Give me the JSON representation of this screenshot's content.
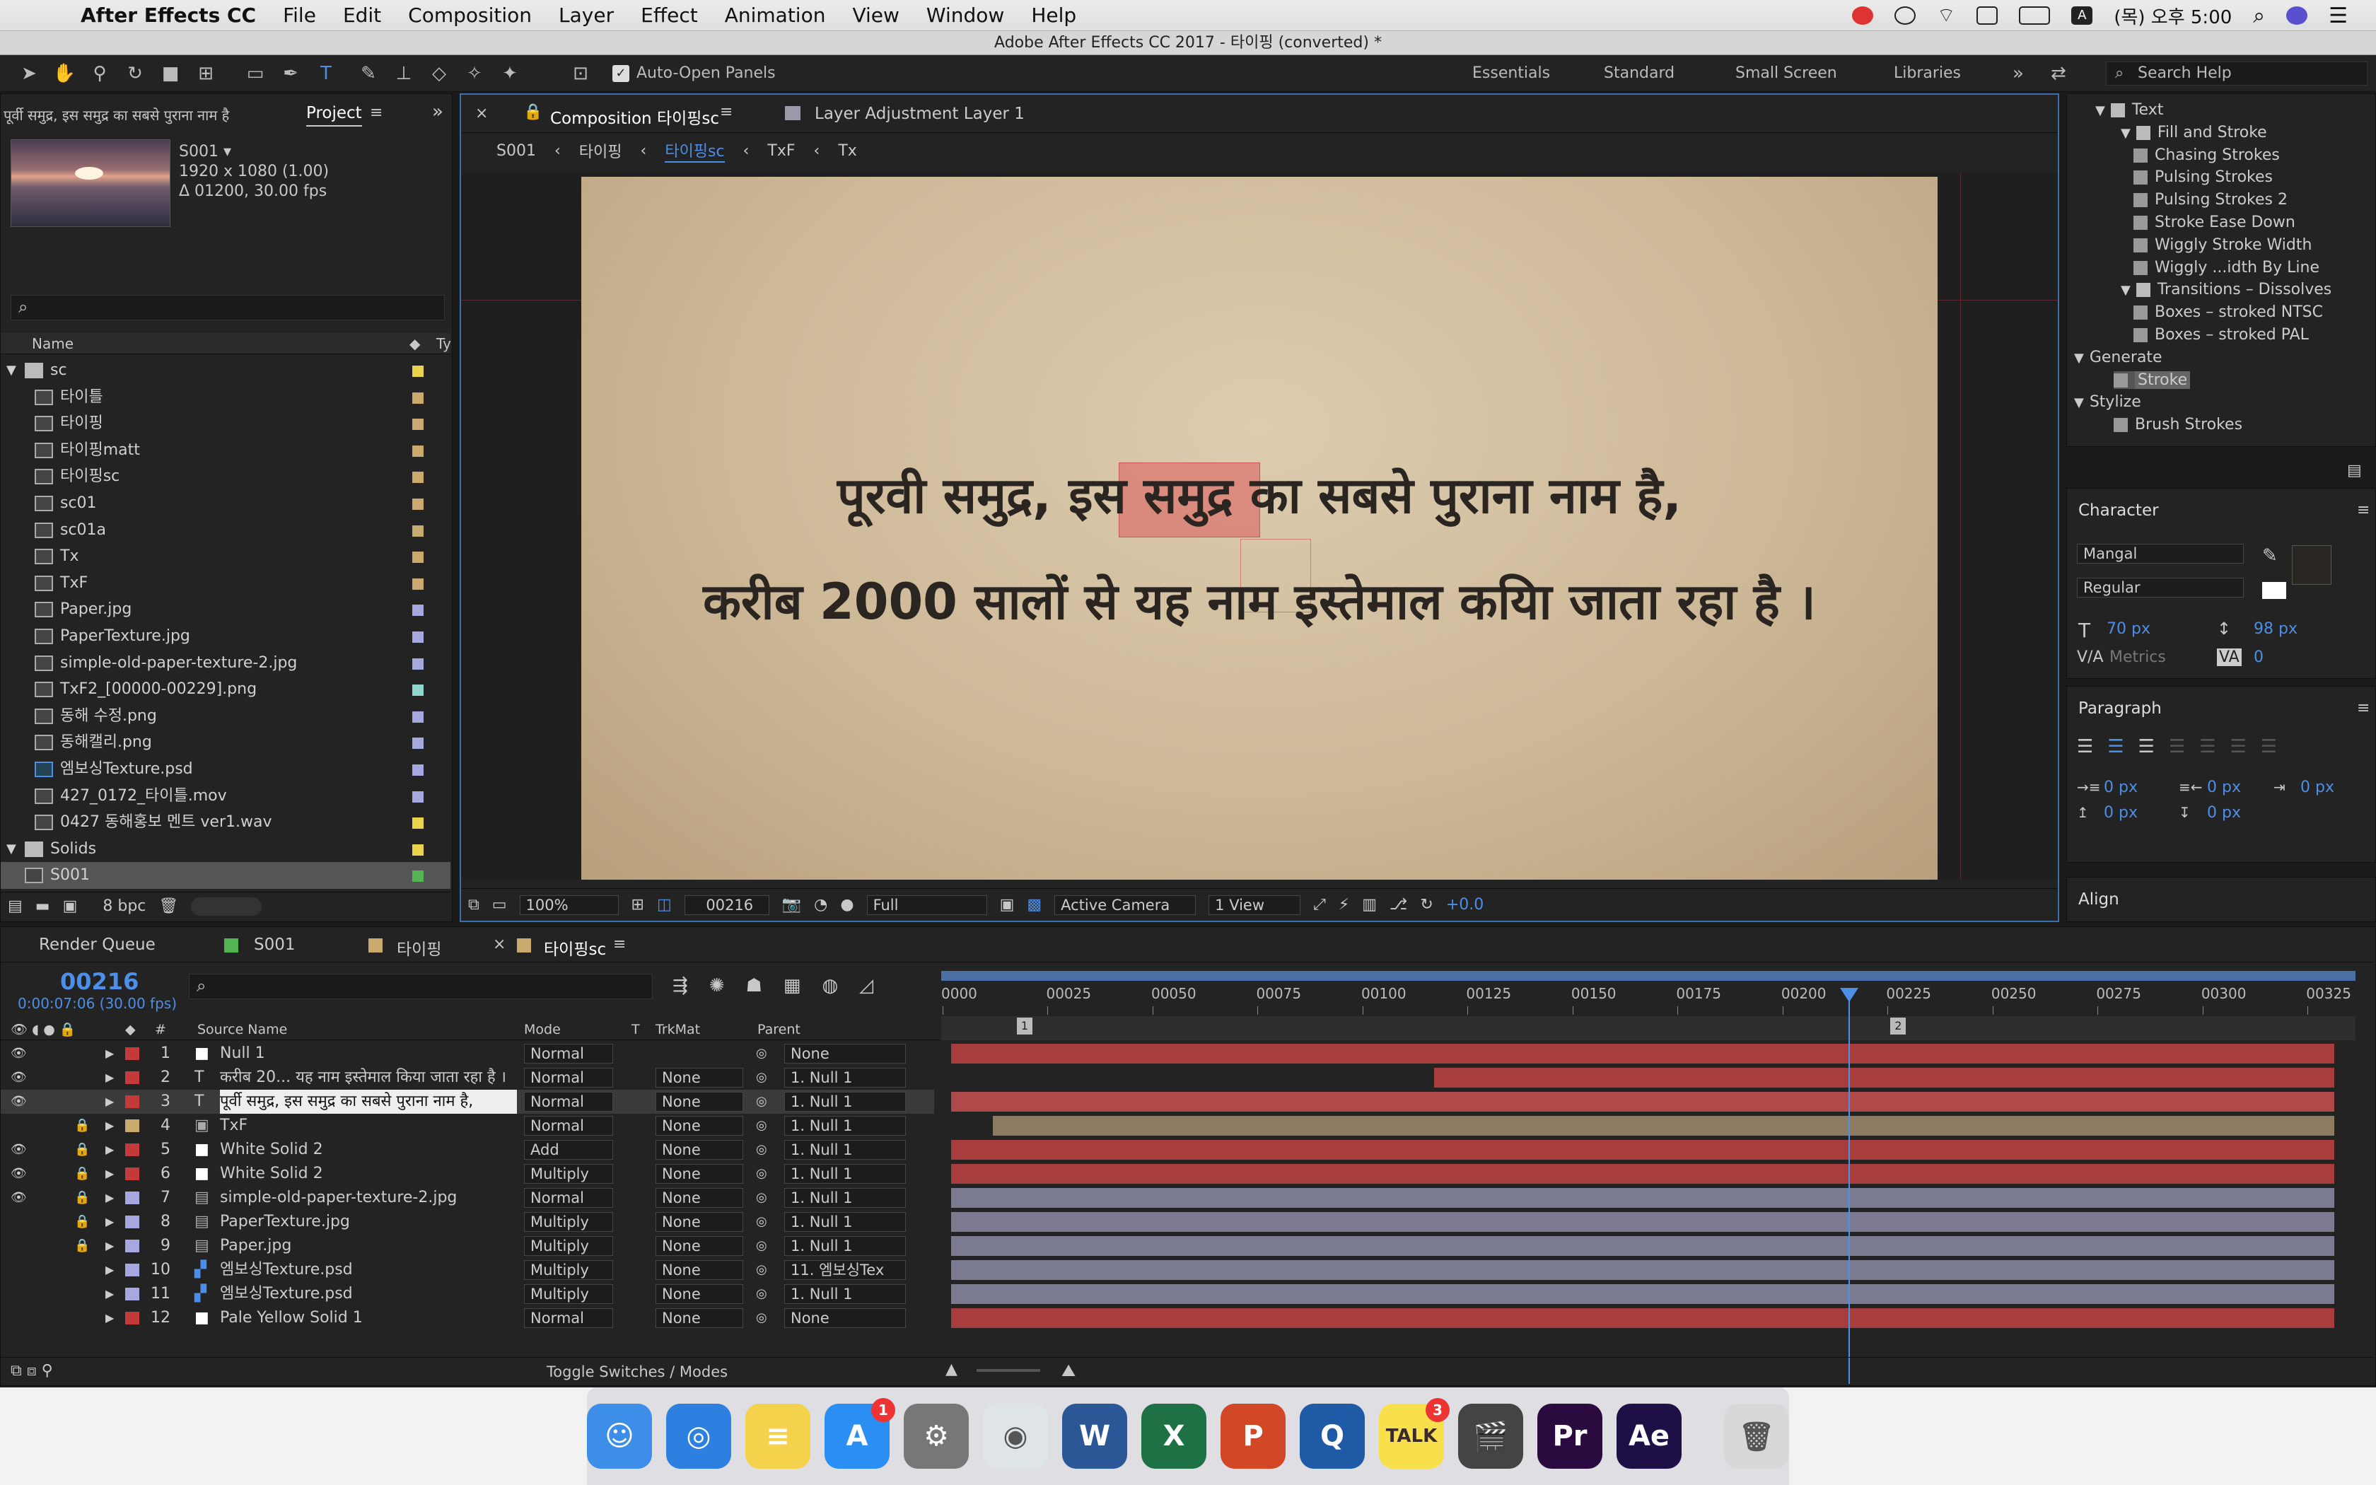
{
  "menubar": {
    "app": "After Effects CC",
    "items": [
      "File",
      "Edit",
      "Composition",
      "Layer",
      "Effect",
      "Animation",
      "View",
      "Window",
      "Help"
    ],
    "clock": "(목) 오후 5:00"
  },
  "window_title": "Adobe After Effects CC 2017 - 타이핑 (converted) *",
  "toolbar": {
    "auto_open_panels": "Auto-Open Panels",
    "workspaces": [
      "Essentials",
      "Standard",
      "Small Screen",
      "Libraries"
    ],
    "search_help": "Search Help"
  },
  "project": {
    "header_text": "पूर्वी समुद्र, इस समुद्र का सबसे पुराना नाम है,",
    "tab": "Project",
    "preview": {
      "name": "S001 ▾",
      "size": "1920 x 1080 (1.00)",
      "duration": "Δ 01200, 30.00 fps"
    },
    "columns": {
      "name": "Name",
      "type": "Ty"
    },
    "items": [
      {
        "name": "sc",
        "kind": "folder",
        "color": "#e8d34a",
        "indent": 0
      },
      {
        "name": "타이틀",
        "kind": "comp",
        "color": "#c9a96e",
        "indent": 1
      },
      {
        "name": "타이핑",
        "kind": "comp",
        "color": "#c9a96e",
        "indent": 1
      },
      {
        "name": "타이핑matt",
        "kind": "comp",
        "color": "#c9a96e",
        "indent": 1
      },
      {
        "name": "타이핑sc",
        "kind": "comp",
        "color": "#c9a96e",
        "indent": 1
      },
      {
        "name": "sc01",
        "kind": "comp",
        "color": "#c9a96e",
        "indent": 1
      },
      {
        "name": "sc01a",
        "kind": "comp",
        "color": "#c9a96e",
        "indent": 1
      },
      {
        "name": "Tx",
        "kind": "comp",
        "color": "#c9a96e",
        "indent": 1
      },
      {
        "name": "TxF",
        "kind": "comp",
        "color": "#c9a96e",
        "indent": 1
      },
      {
        "name": "Paper.jpg",
        "kind": "file",
        "color": "#a8a8e0",
        "indent": 1
      },
      {
        "name": "PaperTexture.jpg",
        "kind": "file",
        "color": "#a8a8e0",
        "indent": 1
      },
      {
        "name": "simple-old-paper-texture-2.jpg",
        "kind": "file",
        "color": "#a8a8e0",
        "indent": 1
      },
      {
        "name": "TxF2_[00000-00229].png",
        "kind": "seq",
        "color": "#8fd6cf",
        "indent": 1
      },
      {
        "name": "동해 수정.png",
        "kind": "file",
        "color": "#a8a8e0",
        "indent": 1
      },
      {
        "name": "동해캘리.png",
        "kind": "file",
        "color": "#a8a8e0",
        "indent": 1
      },
      {
        "name": "엠보싱Texture.psd",
        "kind": "psd",
        "color": "#a8a8e0",
        "indent": 1
      },
      {
        "name": "427_0172_타이틀.mov",
        "kind": "file",
        "color": "#a8a8e0",
        "indent": 1
      },
      {
        "name": "0427 동해홍보 멘트 ver1.wav",
        "kind": "file",
        "color": "#e8d34a",
        "indent": 1
      },
      {
        "name": "Solids",
        "kind": "folder",
        "color": "#e8d34a",
        "indent": 0
      },
      {
        "name": "S001",
        "kind": "comp",
        "color": "#52b452",
        "indent": 0,
        "selected": true
      }
    ],
    "bpc": "8 bpc"
  },
  "comp": {
    "tab": "Composition 타이핑sc",
    "tab2": "Layer Adjustment Layer 1",
    "breadcrumbs": [
      "S001",
      "타이핑",
      "타이핑sc",
      "TxF",
      "Tx"
    ],
    "line1": "पूरवी समुद्र, इस समुद्र का सबसे पुराना नाम है,",
    "line2": "करीब 2000 सालों से यह नाम इस्तेमाल कयिा जाता रहा है ।",
    "footer": {
      "zoom": "100%",
      "time": "00216",
      "resolution": "Full",
      "camera": "Active Camera",
      "views": "1 View",
      "exposure": "+0.0"
    }
  },
  "effects": {
    "items": [
      {
        "name": "Text",
        "level": 0,
        "kind": "folder"
      },
      {
        "name": "Fill and Stroke",
        "level": 1,
        "kind": "folder"
      },
      {
        "name": "Chasing Strokes",
        "level": 2,
        "kind": "preset"
      },
      {
        "name": "Pulsing Strokes",
        "level": 2,
        "kind": "preset"
      },
      {
        "name": "Pulsing Strokes 2",
        "level": 2,
        "kind": "preset"
      },
      {
        "name": "Stroke Ease Down",
        "level": 2,
        "kind": "preset"
      },
      {
        "name": "Wiggly Stroke Width",
        "level": 2,
        "kind": "preset"
      },
      {
        "name": "Wiggly ...idth By Line",
        "level": 2,
        "kind": "preset"
      },
      {
        "name": "Transitions – Dissolves",
        "level": 1,
        "kind": "folder"
      },
      {
        "name": "Boxes – stroked NTSC",
        "level": 2,
        "kind": "preset"
      },
      {
        "name": "Boxes – stroked PAL",
        "level": 2,
        "kind": "preset"
      },
      {
        "name": "Generate",
        "level": -1,
        "kind": "cat"
      },
      {
        "name": "Stroke",
        "level": 1,
        "kind": "effect",
        "selected": true
      },
      {
        "name": "Stylize",
        "level": -1,
        "kind": "cat"
      },
      {
        "name": "Brush Strokes",
        "level": 1,
        "kind": "effect"
      }
    ]
  },
  "character": {
    "title": "Character",
    "font": "Mangal",
    "style": "Regular",
    "size": "70 px",
    "leading": "98 px",
    "kerning": "Metrics",
    "tracking": "0"
  },
  "paragraph": {
    "title": "Paragraph",
    "indent_left": "0 px",
    "indent_right": "0 px",
    "indent_first": "0 px",
    "space_before": "0 px",
    "space_after": "0 px"
  },
  "align": {
    "title": "Align"
  },
  "timeline": {
    "tabs": [
      "Render Queue",
      "S001",
      "타이핑",
      "타이핑sc"
    ],
    "timecode": "00216",
    "timecode_sub": "0:00:07:06 (30.00 fps)",
    "columns": {
      "source": "Source Name",
      "mode": "Mode",
      "t": "T",
      "trkmat": "TrkMat",
      "parent": "Parent"
    },
    "ruler": [
      "0000",
      "00025",
      "00050",
      "00075",
      "00100",
      "00125",
      "00150",
      "00175",
      "00200",
      "00225",
      "00250",
      "00275",
      "00300",
      "00325"
    ],
    "ruler_max": 330,
    "current_frame": 216,
    "markers": [
      {
        "label": "1",
        "frame": 18
      },
      {
        "label": "2",
        "frame": 226
      }
    ],
    "layers": [
      {
        "num": "1",
        "name": "Null 1",
        "icon": "solid",
        "label": "#c23a3a",
        "mode": "Normal",
        "trkmat": "",
        "parent": "None",
        "start": 0,
        "bar": "#a83d3d",
        "eye": true
      },
      {
        "num": "2",
        "name": "करीब 20... यह नाम इस्तेमाल किया जाता रहा है ।",
        "icon": "text",
        "label": "#c23a3a",
        "mode": "Normal",
        "trkmat": "None",
        "parent": "1. Null 1",
        "start": 115,
        "bar": "#a83d3d",
        "eye": true
      },
      {
        "num": "3",
        "name": "पूर्वी समुद्र, इस समुद्र का सबसे पुराना नाम है,",
        "icon": "text",
        "label": "#c23a3a",
        "mode": "Normal",
        "trkmat": "None",
        "parent": "1. Null 1",
        "start": 0,
        "bar": "#b04a4a",
        "eye": true,
        "selected": true
      },
      {
        "num": "4",
        "name": "TxF",
        "icon": "comp",
        "label": "#c9a96e",
        "mode": "Normal",
        "trkmat": "None",
        "parent": "1. Null 1",
        "start": 10,
        "bar": "#8c7a63",
        "eye": false,
        "lock": true
      },
      {
        "num": "5",
        "name": "White Solid 2",
        "icon": "solid",
        "label": "#c23a3a",
        "mode": "Add",
        "trkmat": "None",
        "parent": "1. Null 1",
        "start": 0,
        "bar": "#a83d3d",
        "eye": true,
        "lock": true
      },
      {
        "num": "6",
        "name": "White Solid 2",
        "icon": "solid",
        "label": "#c23a3a",
        "mode": "Multiply",
        "trkmat": "None",
        "parent": "1. Null 1",
        "start": 0,
        "bar": "#a83d3d",
        "eye": true,
        "lock": true
      },
      {
        "num": "7",
        "name": "simple-old-paper-texture-2.jpg",
        "icon": "file",
        "label": "#a8a8e0",
        "mode": "Normal",
        "trkmat": "None",
        "parent": "1. Null 1",
        "start": 0,
        "bar": "#7a7a90",
        "eye": true,
        "lock": true
      },
      {
        "num": "8",
        "name": "PaperTexture.jpg",
        "icon": "file",
        "label": "#a8a8e0",
        "mode": "Multiply",
        "trkmat": "None",
        "parent": "1. Null 1",
        "start": 0,
        "bar": "#7a7a90",
        "eye": false,
        "lock": true
      },
      {
        "num": "9",
        "name": "Paper.jpg",
        "icon": "file",
        "label": "#a8a8e0",
        "mode": "Multiply",
        "trkmat": "None",
        "parent": "1. Null 1",
        "start": 0,
        "bar": "#7a7a90",
        "eye": false,
        "lock": true
      },
      {
        "num": "10",
        "name": "엠보싱Texture.psd",
        "icon": "psd",
        "label": "#a8a8e0",
        "mode": "Multiply",
        "trkmat": "None",
        "parent": "11. 엠보싱Tex",
        "start": 0,
        "bar": "#7a7a90",
        "eye": false
      },
      {
        "num": "11",
        "name": "엠보싱Texture.psd",
        "icon": "psd",
        "label": "#a8a8e0",
        "mode": "Multiply",
        "trkmat": "None",
        "parent": "1. Null 1",
        "start": 0,
        "bar": "#7a7a90",
        "eye": false
      },
      {
        "num": "12",
        "name": "Pale Yellow Solid 1",
        "icon": "solid",
        "label": "#c23a3a",
        "mode": "Normal",
        "trkmat": "None",
        "parent": "None",
        "start": 0,
        "bar": "#a83d3d",
        "eye": false
      }
    ],
    "toggle": "Toggle Switches / Modes"
  },
  "dock": [
    {
      "name": "Finder",
      "color": "#3d8ee8",
      "glyph": "☺"
    },
    {
      "name": "Safari",
      "color": "#2d7fe0",
      "glyph": "◎"
    },
    {
      "name": "Notes",
      "color": "#f5d24c",
      "glyph": "≡"
    },
    {
      "name": "App Store",
      "color": "#2b8ef2",
      "glyph": "A",
      "badge": "1"
    },
    {
      "name": "System Preferences",
      "color": "#777",
      "glyph": "⚙"
    },
    {
      "name": "Chrome",
      "color": "#dfe4e8",
      "glyph": "◉"
    },
    {
      "name": "Word",
      "color": "#2b5797",
      "glyph": "W"
    },
    {
      "name": "Excel",
      "color": "#1e7145",
      "glyph": "X"
    },
    {
      "name": "PowerPoint",
      "color": "#d24726",
      "glyph": "P"
    },
    {
      "name": "QuickTime",
      "color": "#1f5aa6",
      "glyph": "Q"
    },
    {
      "name": "KakaoTalk",
      "color": "#f7e04b",
      "glyph": "TALK",
      "badge": "3"
    },
    {
      "name": "Final Cut",
      "color": "#444",
      "glyph": "🎬"
    },
    {
      "name": "Premiere",
      "color": "#2a0a3f",
      "glyph": "Pr"
    },
    {
      "name": "After Effects",
      "color": "#1e1046",
      "glyph": "Ae"
    },
    {
      "name": "Trash",
      "color": "#d8d8d8",
      "glyph": "🗑"
    }
  ]
}
